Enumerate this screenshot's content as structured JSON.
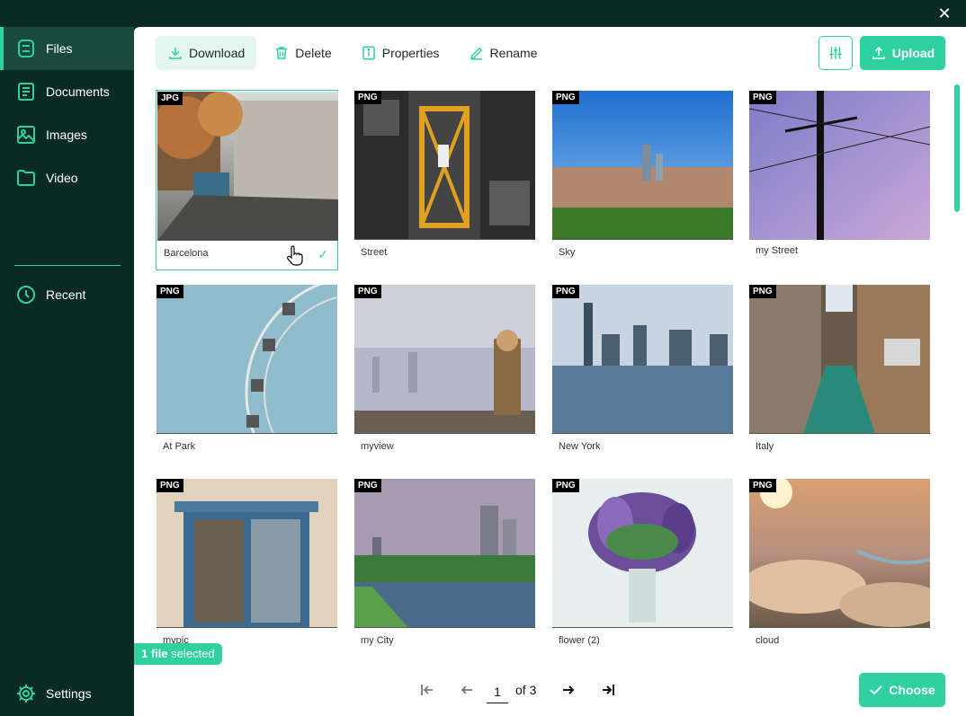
{
  "window": {
    "close_label": "✕"
  },
  "sidebar": {
    "items": [
      {
        "label": "Files",
        "icon": "files-icon",
        "active": true
      },
      {
        "label": "Documents",
        "icon": "documents-icon",
        "active": false
      },
      {
        "label": "Images",
        "icon": "images-icon",
        "active": false
      },
      {
        "label": "Video",
        "icon": "folder-icon",
        "active": false
      }
    ],
    "recent_label": "Recent",
    "settings_label": "Settings"
  },
  "toolbar": {
    "download_label": "Download",
    "delete_label": "Delete",
    "properties_label": "Properties",
    "rename_label": "Rename",
    "upload_label": "Upload"
  },
  "files": [
    {
      "name": "Barcelona",
      "type": "JPG",
      "selected": true
    },
    {
      "name": "Street",
      "type": "PNG",
      "selected": false
    },
    {
      "name": "Sky",
      "type": "PNG",
      "selected": false
    },
    {
      "name": "my Street",
      "type": "PNG",
      "selected": false
    },
    {
      "name": "At Park",
      "type": "PNG",
      "selected": false
    },
    {
      "name": "myview",
      "type": "PNG",
      "selected": false
    },
    {
      "name": "New York",
      "type": "PNG",
      "selected": false
    },
    {
      "name": "Italy",
      "type": "PNG",
      "selected": false
    },
    {
      "name": "mypic",
      "type": "PNG",
      "selected": false
    },
    {
      "name": "my City",
      "type": "PNG",
      "selected": false
    },
    {
      "name": "flower (2)",
      "type": "PNG",
      "selected": false
    },
    {
      "name": "cloud",
      "type": "PNG",
      "selected": false
    }
  ],
  "selection": {
    "count": "1 file",
    "suffix": " selected"
  },
  "pager": {
    "current": "1",
    "of_label": "of 3"
  },
  "choose_label": "Choose",
  "colors": {
    "accent": "#2fd1a1",
    "sidebar_bg": "#0a2b24",
    "active_bg": "#1a4a3e"
  }
}
